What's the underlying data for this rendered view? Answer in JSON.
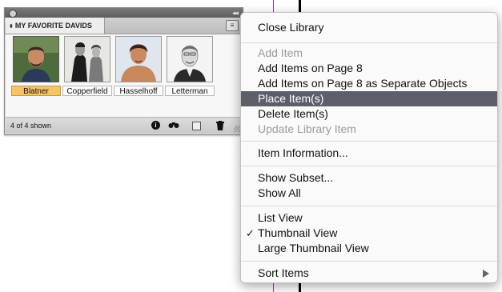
{
  "panel": {
    "tab_label": "MY FAVORITE DAVIDS",
    "tab_arrows": "⬍",
    "collapse_glyph": "◂◂",
    "menu_glyph": "≡",
    "items": [
      {
        "label": "Blatner",
        "selected": true
      },
      {
        "label": "Copperfield",
        "selected": false
      },
      {
        "label": "Hasselhoff",
        "selected": false
      },
      {
        "label": "Letterman",
        "selected": false
      }
    ],
    "status": "4 of 4 shown",
    "icons": [
      "info-icon",
      "binoculars-icon",
      "new-item-icon",
      "trash-icon"
    ]
  },
  "menu": {
    "items": [
      {
        "label": "Close Library",
        "state": "normal"
      },
      {
        "label": "Add Item",
        "state": "disabled"
      },
      {
        "label": "Add Items on Page 8",
        "state": "normal"
      },
      {
        "label": "Add Items on Page 8 as Separate Objects",
        "state": "normal"
      },
      {
        "label": "Place Item(s)",
        "state": "highlighted"
      },
      {
        "label": "Delete Item(s)",
        "state": "normal"
      },
      {
        "label": "Update Library Item",
        "state": "disabled"
      },
      {
        "label": "Item Information...",
        "state": "normal"
      },
      {
        "label": "Show Subset...",
        "state": "normal"
      },
      {
        "label": "Show All",
        "state": "normal"
      },
      {
        "label": "List View",
        "state": "normal"
      },
      {
        "label": "Thumbnail View",
        "state": "checked"
      },
      {
        "label": "Large Thumbnail View",
        "state": "normal"
      },
      {
        "label": "Sort Items",
        "state": "submenu"
      }
    ],
    "check_glyph": "✓"
  },
  "colors": {
    "highlight": "#5a5f6a",
    "selected_label": "#f5c565",
    "magenta_guide": "#b02fb8"
  }
}
